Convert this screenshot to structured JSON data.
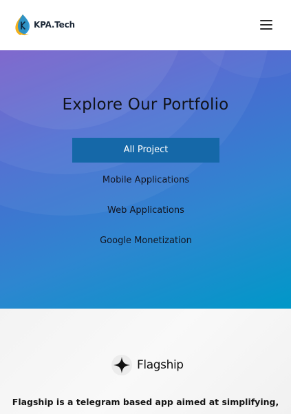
{
  "header": {
    "logo_text": "KPA.Tech",
    "menu_icon": "hamburger-menu-icon"
  },
  "hero": {
    "title": "Explore Our Portfolio",
    "filters": [
      {
        "label": "All Project",
        "active": true
      },
      {
        "label": "Mobile Applications",
        "active": false
      },
      {
        "label": "Web Applications",
        "active": false
      },
      {
        "label": "Google Monetization",
        "active": false
      }
    ]
  },
  "project": {
    "brand_icon": "sparkle-star-icon",
    "name": "Flagship",
    "description": "Flagship is a telegram based app aimed at simplifying,"
  },
  "colors": {
    "active_filter_bg": "#1568a8",
    "hero_gradient_start": "#6a4fc6",
    "hero_gradient_end": "#0098c8"
  }
}
